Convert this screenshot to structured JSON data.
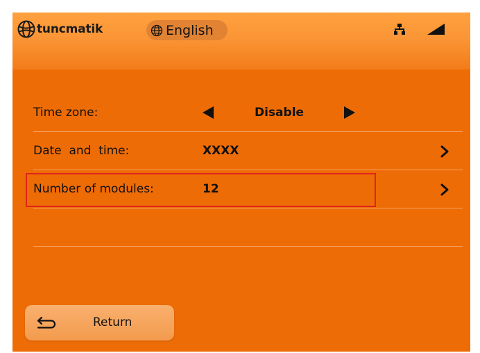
{
  "header": {
    "brand": "tuncmatik",
    "language": "English",
    "icons": {
      "logo": "globe-outline-icon",
      "language": "globe-icon",
      "network": "network-icon",
      "signal": "signal-icon"
    }
  },
  "settings": {
    "rows": [
      {
        "label": "Time zone:",
        "value": "Disable",
        "control": "left-right-arrows"
      },
      {
        "label": "Date  and  time:",
        "value": "XXXX",
        "control": "chevron-right"
      },
      {
        "label": "Number of modules:",
        "value": "12",
        "control": "chevron-right",
        "highlighted": true
      }
    ]
  },
  "footer": {
    "return_label": "Return",
    "return_icon": "return-arrow-icon"
  },
  "colors": {
    "background": "#ee6c06",
    "header_top": "#ffa13f",
    "highlight_border": "#e0241a",
    "divider": "#f5a261",
    "button": "#f6a55e"
  }
}
